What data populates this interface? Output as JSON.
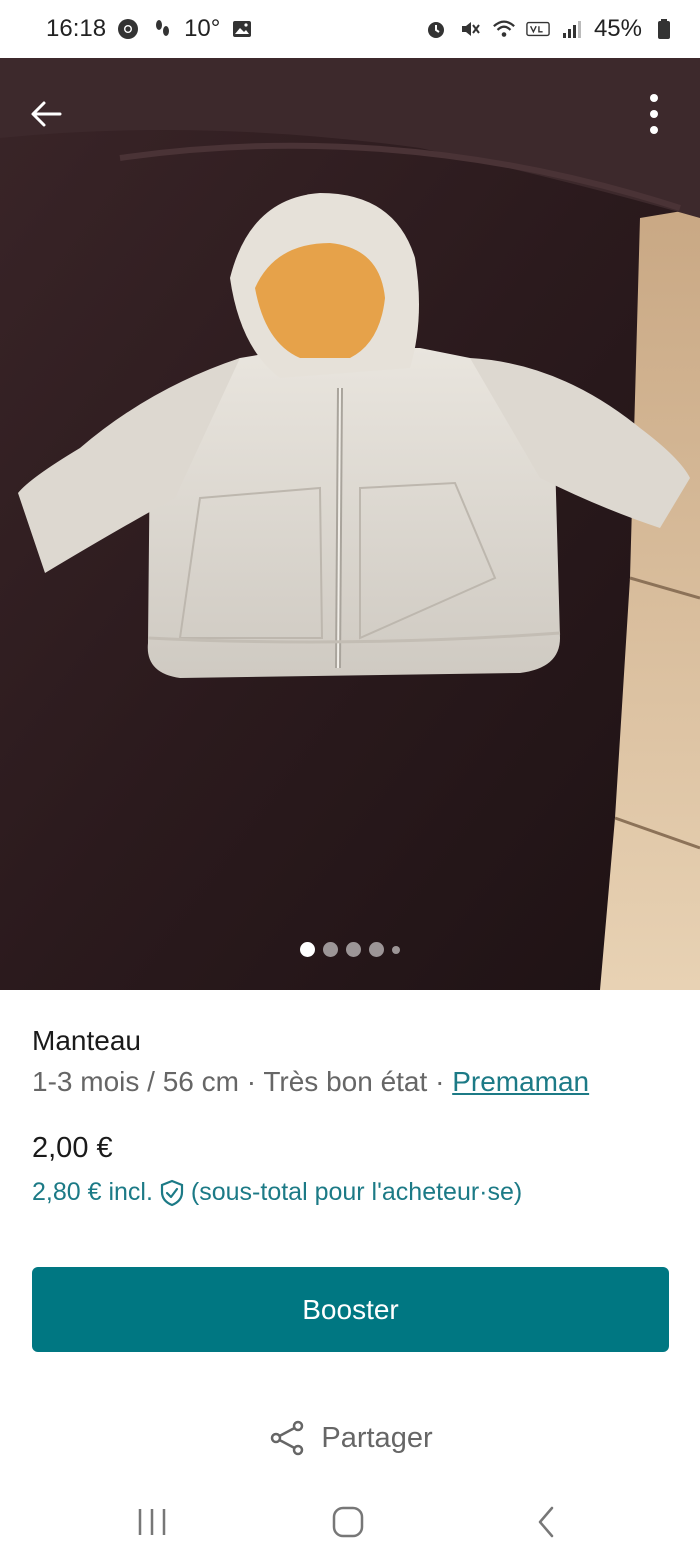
{
  "status_bar": {
    "time": "16:18",
    "temperature": "10°",
    "battery": "45%"
  },
  "photo": {
    "carousel": {
      "total": 5,
      "active_index": 1
    }
  },
  "item": {
    "title": "Manteau",
    "size": "1-3 mois / 56 cm",
    "separator": " · ",
    "condition": "Très bon état",
    "brand": "Premaman",
    "price": "2,00 €",
    "price_incl": "2,80 € incl.",
    "price_incl_note": "(sous-total pour l'acheteur·se)"
  },
  "actions": {
    "booster_label": "Booster",
    "share_label": "Partager"
  },
  "colors": {
    "accent": "#007782",
    "link": "#1c7a86"
  }
}
